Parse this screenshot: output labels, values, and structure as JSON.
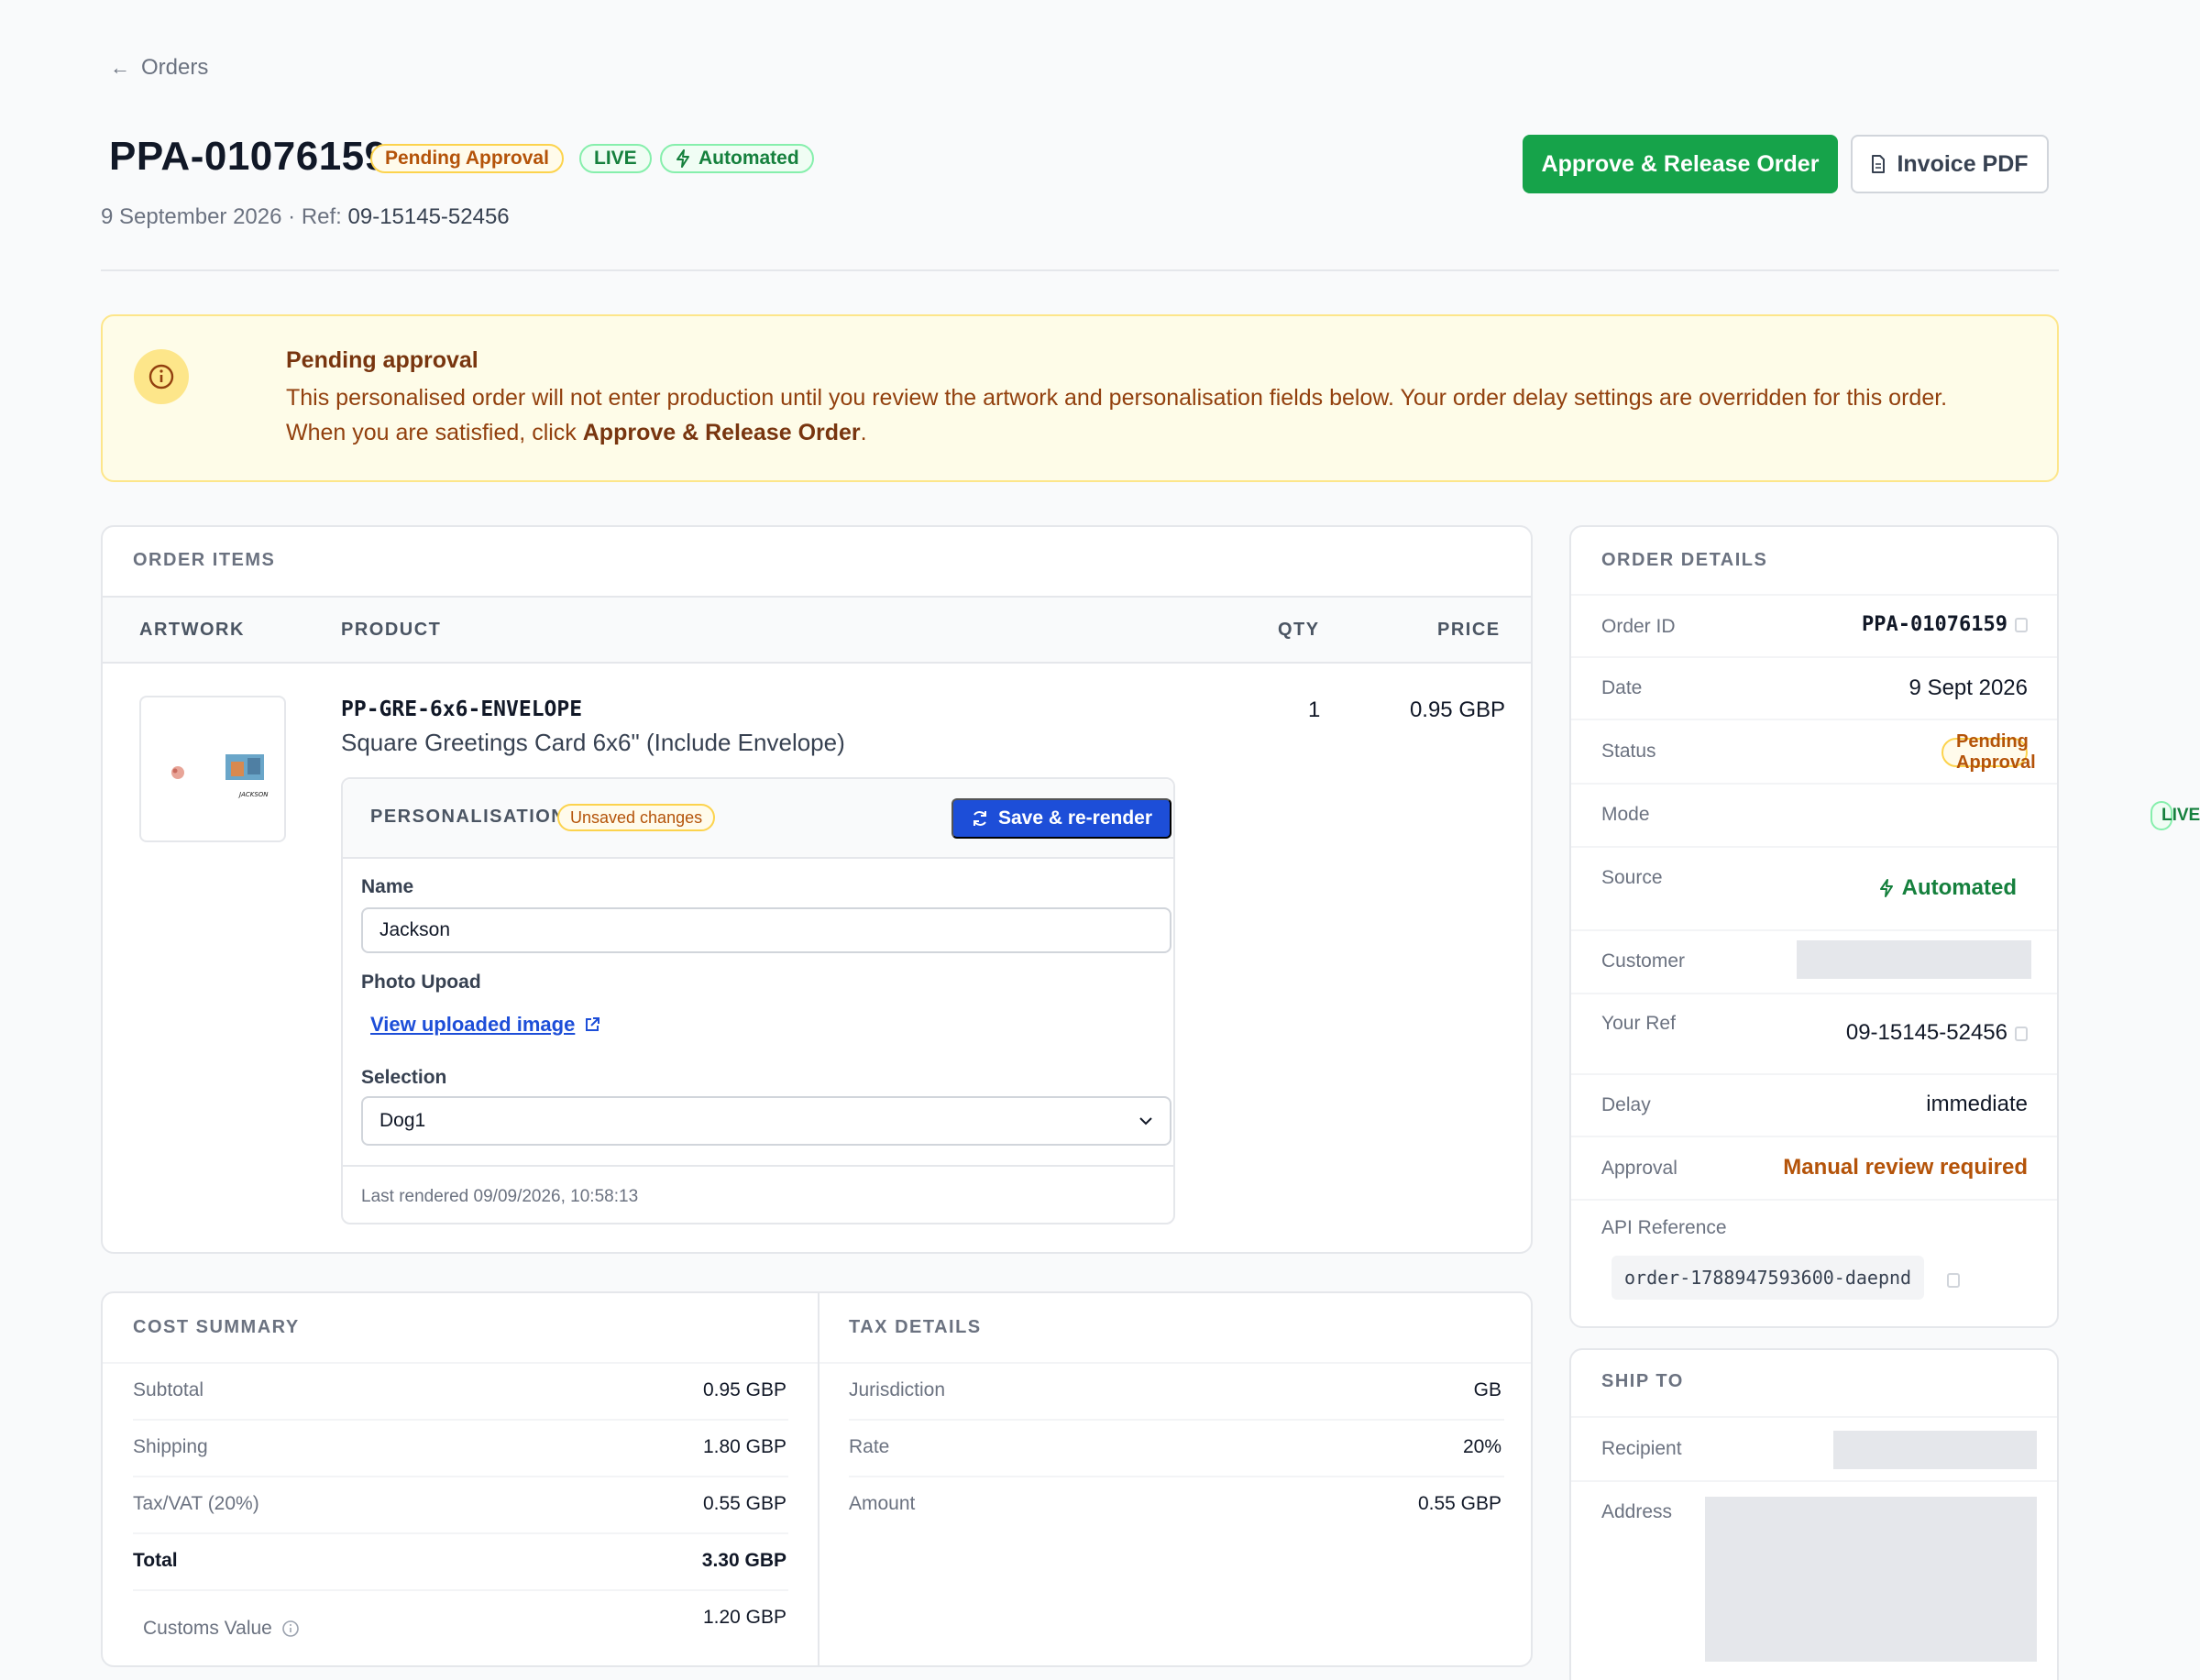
{
  "nav": {
    "back_label": "Orders"
  },
  "header": {
    "order_id": "PPA-01076159",
    "badges": {
      "pending": "Pending Approval",
      "live": "LIVE",
      "automated": "Automated"
    },
    "date": "9 September 2026",
    "ref_prefix": " · Ref: ",
    "ref_value": "09-15145-52456",
    "approve_label": "Approve & Release Order",
    "invoice_label": "Invoice PDF"
  },
  "alert": {
    "title": "Pending approval",
    "body_1": "This personalised order will not enter production until you review the artwork and personalisation fields below. Your order delay settings are overridden for this order. When you are satisfied, click ",
    "body_bold": "Approve & Release Order",
    "body_2": "."
  },
  "items": {
    "section_label": "ORDER ITEMS",
    "columns": {
      "artwork": "ARTWORK",
      "product": "PRODUCT",
      "qty": "QTY",
      "price": "PRICE"
    },
    "row": {
      "sku": "PP-GRE-6x6-ENVELOPE",
      "name": "Square Greetings Card 6x6\" (Include Envelope)",
      "qty": "1",
      "price": "0.95 GBP",
      "thumb_text": "JACKSON"
    },
    "personalisation": {
      "label": "PERSONALISATION",
      "unsaved": "Unsaved changes",
      "save_label": "Save & re-render",
      "name_label": "Name",
      "name_value": "Jackson",
      "photo_label": "Photo Upoad",
      "photo_link": "View uploaded image",
      "selection_label": "Selection",
      "selection_value": "Dog1",
      "last_rendered": "Last rendered 09/09/2026, 10:58:13"
    }
  },
  "cost": {
    "section_label": "COST SUMMARY",
    "rows": [
      {
        "label": "Subtotal",
        "value": "0.95 GBP"
      },
      {
        "label": "Shipping",
        "value": "1.80 GBP"
      },
      {
        "label": "Tax/VAT (20%)",
        "value": "0.55 GBP"
      },
      {
        "label": "Total",
        "value": "3.30 GBP"
      },
      {
        "label": "Customs Value",
        "value": "1.20 GBP"
      }
    ]
  },
  "tax": {
    "section_label": "TAX DETAILS",
    "rows": [
      {
        "label": "Jurisdiction",
        "value": "GB"
      },
      {
        "label": "Rate",
        "value": "20%"
      },
      {
        "label": "Amount",
        "value": "0.55 GBP"
      }
    ]
  },
  "details": {
    "section_label": "ORDER DETAILS",
    "order_id_label": "Order ID",
    "order_id_value": "PPA-01076159",
    "date_label": "Date",
    "date_value": "9 Sept 2026",
    "status_label": "Status",
    "status_value": "Pending Approval",
    "mode_label": "Mode",
    "mode_value": "LIVE",
    "source_label": "Source",
    "source_value": "Automated",
    "customer_label": "Customer",
    "ref_label": "Your Ref",
    "ref_value": "09-15145-52456",
    "delay_label": "Delay",
    "delay_value": "immediate",
    "approval_label": "Approval",
    "approval_value": "Manual review required",
    "api_label": "API Reference",
    "api_value": "order-1788947593600-daepnd"
  },
  "ship": {
    "section_label": "SHIP TO",
    "recipient_label": "Recipient",
    "address_label": "Address"
  },
  "colors": {
    "approve_green": "#16a34a",
    "save_blue": "#1d4ed8",
    "pending_amber": "#b45309",
    "approval_text": "#b45309"
  }
}
